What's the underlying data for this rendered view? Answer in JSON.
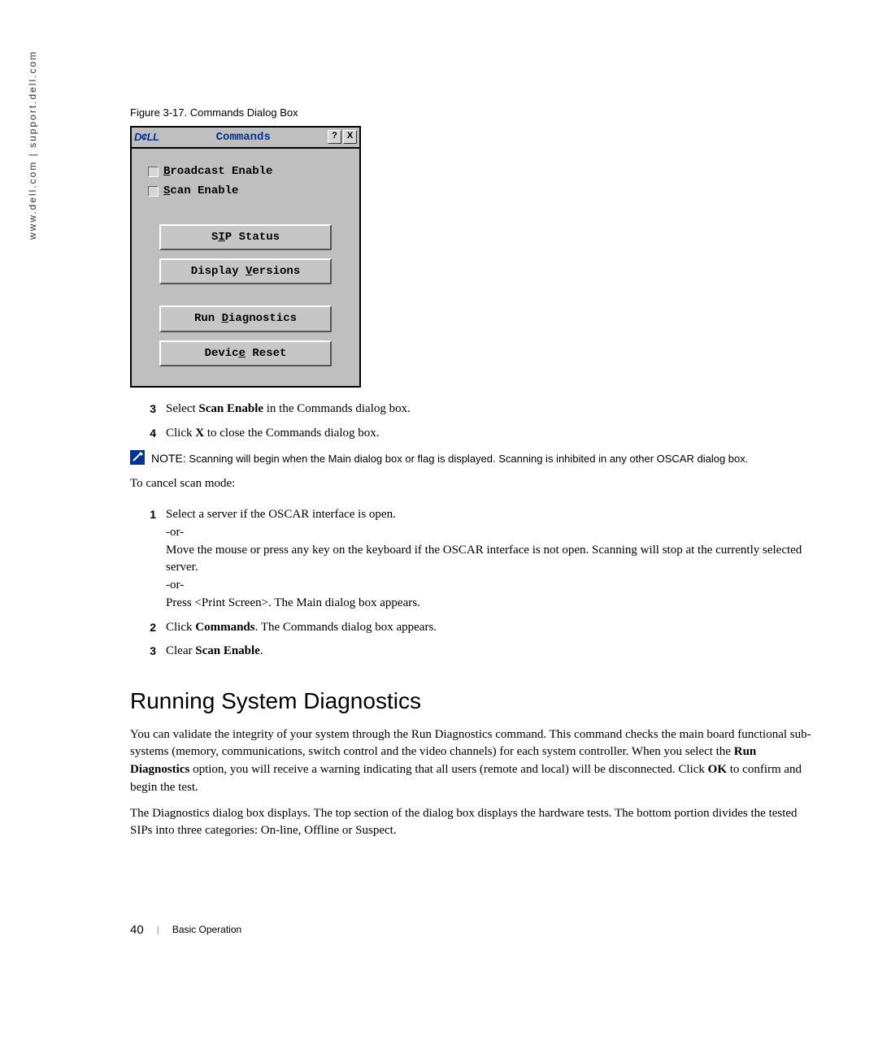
{
  "sidebar_url": "www.dell.com | support.dell.com",
  "figure_caption": "Figure 3-17.    Commands Dialog Box",
  "dialog": {
    "logo": "D¢LL",
    "title": "Commands",
    "help_icon": "?",
    "close_icon": "X",
    "checkbox_broadcast_prefix": "B",
    "checkbox_broadcast_rest": "roadcast Enable",
    "checkbox_scan_prefix": "S",
    "checkbox_scan_rest": "can Enable",
    "btn_sip_pre": "S",
    "btn_sip_u": "I",
    "btn_sip_post": "P Status",
    "btn_versions_pre": "Display ",
    "btn_versions_u": "V",
    "btn_versions_post": "ersions",
    "btn_diag_pre": "Run ",
    "btn_diag_u": "D",
    "btn_diag_post": "iagnostics",
    "btn_reset_pre": "Devic",
    "btn_reset_u": "e",
    "btn_reset_post": " Reset"
  },
  "steps_a": {
    "n3": "3",
    "t3_pre": "Select ",
    "t3_bold": "Scan Enable",
    "t3_post": " in the Commands dialog box.",
    "n4": "4",
    "t4_pre": "Click ",
    "t4_bold": "X",
    "t4_post": " to close the Commands dialog box."
  },
  "note": {
    "label": "NOTE:",
    "text": " Scanning will begin when the Main dialog box or flag is displayed. Scanning is inhibited in any other OSCAR dialog box."
  },
  "cancel_intro": "To cancel scan mode:",
  "steps_b": {
    "n1": "1",
    "t1_l1": "Select a server if the OSCAR interface is open.",
    "t1_or1": "-or-",
    "t1_l2": "Move the mouse or press any key on the keyboard if the OSCAR interface is not open. Scanning will stop at the currently selected server.",
    "t1_or2": "-or-",
    "t1_l3": "Press <Print Screen>. The Main dialog box appears.",
    "n2": "2",
    "t2_pre": "Click ",
    "t2_bold": "Commands",
    "t2_post": ". The Commands dialog box appears.",
    "n3": "3",
    "t3_pre": "Clear ",
    "t3_bold": "Scan Enable",
    "t3_post": "."
  },
  "heading": "Running System Diagnostics",
  "para1_a": "You can validate the integrity of your system through the Run Diagnostics command. This command checks the main board functional sub-systems (memory, communications, switch control and the video channels) for each system controller. When you select the ",
  "para1_b": "Run Diagnostics",
  "para1_c": " option, you will receive a warning indicating that all users (remote and local) will be disconnected. Click ",
  "para1_d": "OK",
  "para1_e": " to confirm and begin the test.",
  "para2": "The Diagnostics dialog box displays. The top section of the dialog box displays the hardware tests. The bottom portion divides the tested SIPs into three categories: On-line, Offline or Suspect.",
  "footer": {
    "pagenum": "40",
    "sep": "|",
    "section": "Basic Operation"
  }
}
